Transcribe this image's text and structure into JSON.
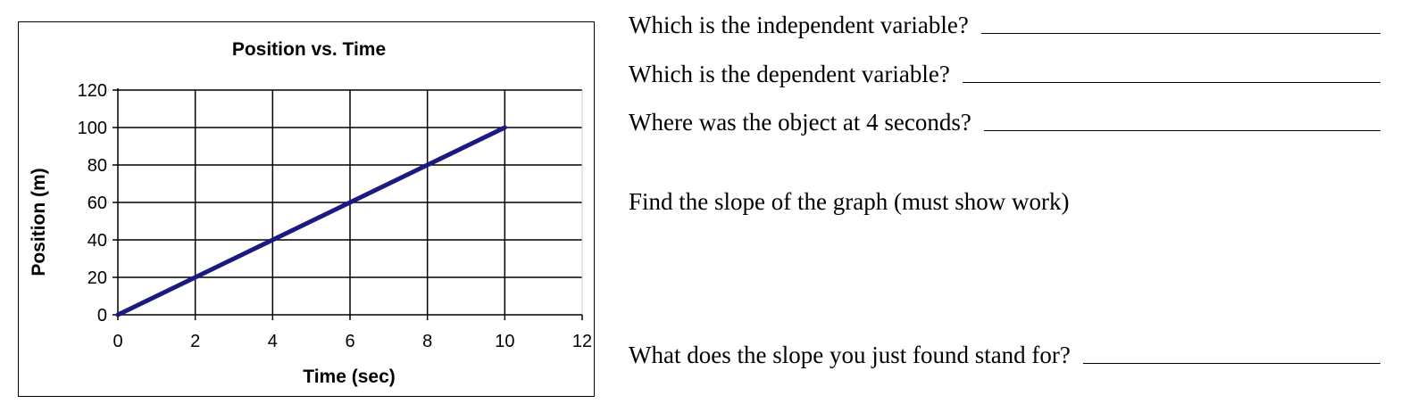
{
  "chart_data": {
    "type": "line",
    "title": "Position vs. Time",
    "xlabel": "Time (sec)",
    "ylabel": "Position (m)",
    "xlim": [
      0,
      12
    ],
    "ylim": [
      0,
      120
    ],
    "xticks": [
      0,
      2,
      4,
      6,
      8,
      10,
      12
    ],
    "yticks": [
      0,
      20,
      40,
      60,
      80,
      100,
      120
    ],
    "grid": true,
    "line_color": "#1a1a80",
    "series": [
      {
        "x": [
          0,
          1,
          2,
          3,
          4,
          5,
          6,
          7,
          8,
          9,
          10
        ],
        "y": [
          0,
          10,
          20,
          30,
          40,
          50,
          60,
          70,
          80,
          90,
          100
        ]
      }
    ]
  },
  "questions": [
    {
      "text": "Which is the independent variable?"
    },
    {
      "text": "Which is the dependent variable?"
    },
    {
      "text": "Where was the object at 4 seconds?"
    },
    {
      "text": "Find the slope of the graph (must show work)"
    },
    {
      "text": "What does the slope you just found stand for?"
    }
  ]
}
